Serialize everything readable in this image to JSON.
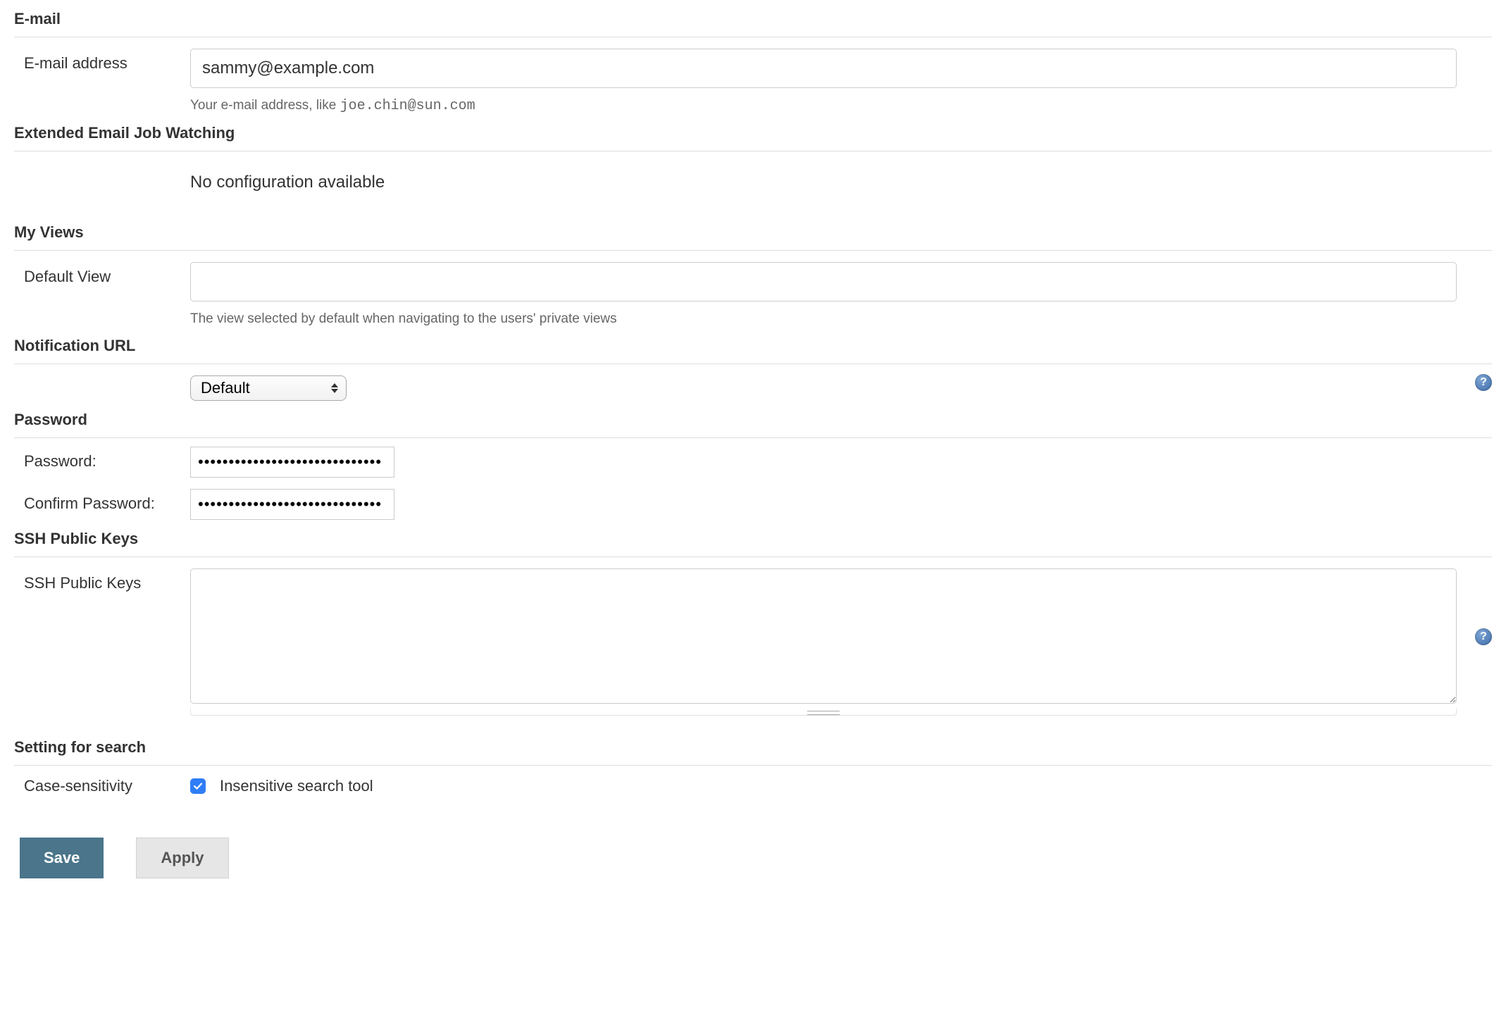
{
  "sections": {
    "email": {
      "title": "E-mail",
      "address_label": "E-mail address",
      "address_value": "sammy@example.com",
      "help_prefix": "Your e-mail address, like ",
      "help_code": "joe.chin@sun.com"
    },
    "extended_email": {
      "title": "Extended Email Job Watching",
      "message": "No configuration available"
    },
    "my_views": {
      "title": "My Views",
      "default_label": "Default View",
      "default_value": "",
      "help": "The view selected by default when navigating to the users' private views"
    },
    "notification": {
      "title": "Notification URL",
      "selected": "Default"
    },
    "password": {
      "title": "Password",
      "pw_label": "Password:",
      "confirm_label": "Confirm Password:",
      "masked": "••••••••••••••••••••••••••••••"
    },
    "ssh": {
      "title": "SSH Public Keys",
      "label": "SSH Public Keys",
      "value": ""
    },
    "search": {
      "title": "Setting for search",
      "case_label": "Case-sensitivity",
      "checkbox_checked": true,
      "checkbox_label": "Insensitive search tool"
    }
  },
  "actions": {
    "save": "Save",
    "apply": "Apply"
  }
}
